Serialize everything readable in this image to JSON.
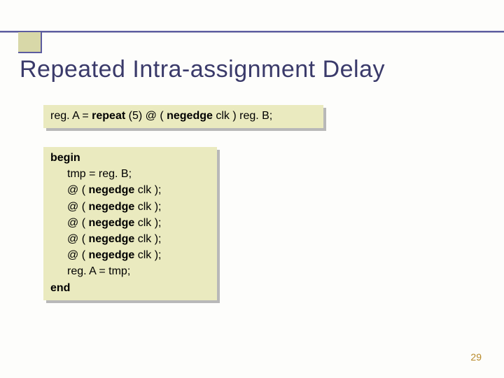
{
  "title": "Repeated Intra-assignment Delay",
  "box1": {
    "pre": "reg. A = ",
    "kw1": "repeat",
    "mid1": " (5) @ ( ",
    "kw2": "negedge",
    "mid2": " clk ) reg. B;"
  },
  "box2": {
    "begin": "begin",
    "l1": "tmp = reg. B;",
    "at": "@ ( ",
    "neg": "negedge",
    "tail": " clk );",
    "last": "reg. A = tmp;",
    "end": "end"
  },
  "pageNum": "29"
}
